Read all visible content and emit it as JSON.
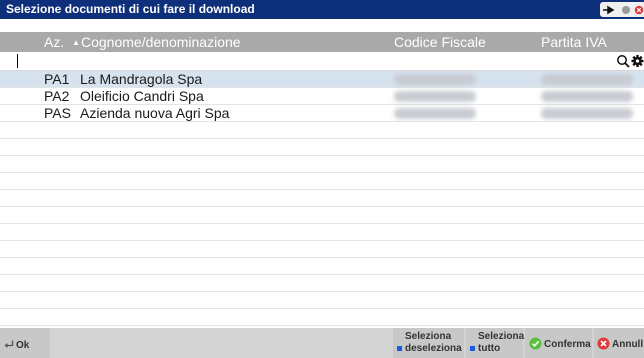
{
  "window": {
    "title": "Selezione documenti di cui fare il download"
  },
  "columns": {
    "az": "Az.",
    "sort_indicator": "▲",
    "name": "Cognome/denominazione",
    "codice_fiscale": "Codice Fiscale",
    "partita_iva": "Partita IVA"
  },
  "search": {
    "value": ""
  },
  "rows": [
    {
      "az": "PA1",
      "name": "La Mandragola Spa",
      "selected": true
    },
    {
      "az": "PA2",
      "name": "Oleificio Candri Spa",
      "selected": false
    },
    {
      "az": "PAS",
      "name": "Azienda nuova Agri Spa",
      "selected": false
    }
  ],
  "buttons": {
    "ok": "Ok",
    "seleziona_deseleziona": [
      "Seleziona",
      "deseleziona"
    ],
    "seleziona_tutto": [
      "Seleziona",
      "tutto"
    ],
    "conferma": "Conferma",
    "annulla": "Annull"
  },
  "colors": {
    "titlebar": "#0e2f7a",
    "header": "#a9a9a9",
    "selected_row": "#d6e2ee",
    "confirm_green": "#5bbf3a",
    "cancel_red": "#e03a3a"
  },
  "icons": {
    "titlebar": [
      "pin-icon",
      "minimize-icon",
      "close-icon"
    ],
    "search_row": [
      "search-icon",
      "gear-icon"
    ],
    "buttons": [
      "enter-arrow-icon",
      "select-square-icon",
      "check-icon",
      "cancel-x-icon"
    ]
  }
}
